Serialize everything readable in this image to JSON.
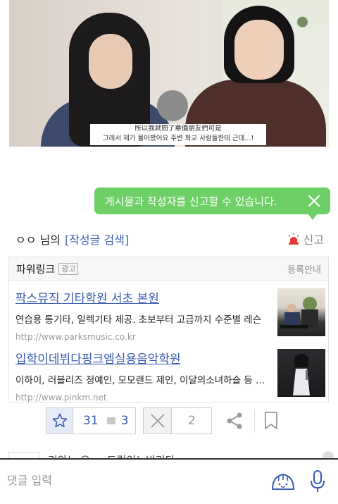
{
  "video": {
    "subtitle_line1": "所以我就問了華僑朋友們可是",
    "subtitle_line2": "그래서 제가 물어봤어요 주변 화교 사람들한테 근데...!"
  },
  "toast": {
    "message": "게시물과 작성자를 신고할 수 있습니다.",
    "color": "#6fcf67"
  },
  "author": {
    "name": "ㅇㅇ 님의",
    "search_link": "[작성글 검색]",
    "report_label": "신고"
  },
  "powerlink": {
    "title": "파워링크",
    "ad_badge": "광고",
    "register": "등록안내",
    "ads": [
      {
        "title": "팍스뮤직 기타학원 서초 본원",
        "desc": "연습용 통기타, 일렉기타 제공. 초보부터 고급까지 수준별 레슨",
        "url": "http://www.parksmusic.co.kr"
      },
      {
        "title": "입학이데뷔다핑크엠실용음악학원",
        "desc": "이하이, 러블리즈 정예인, 모모랜드 제인, 이달의소녀하슬 등 배출",
        "url": "http://www.pinkm.net"
      }
    ]
  },
  "actions": {
    "recommend_count": "31",
    "comment_count": "3",
    "not_recommend_count": "2"
  },
  "next_row": {
    "text": "리아노 오 ... 드림이노비리다"
  },
  "comment_bar": {
    "placeholder": "댓글 입력"
  }
}
